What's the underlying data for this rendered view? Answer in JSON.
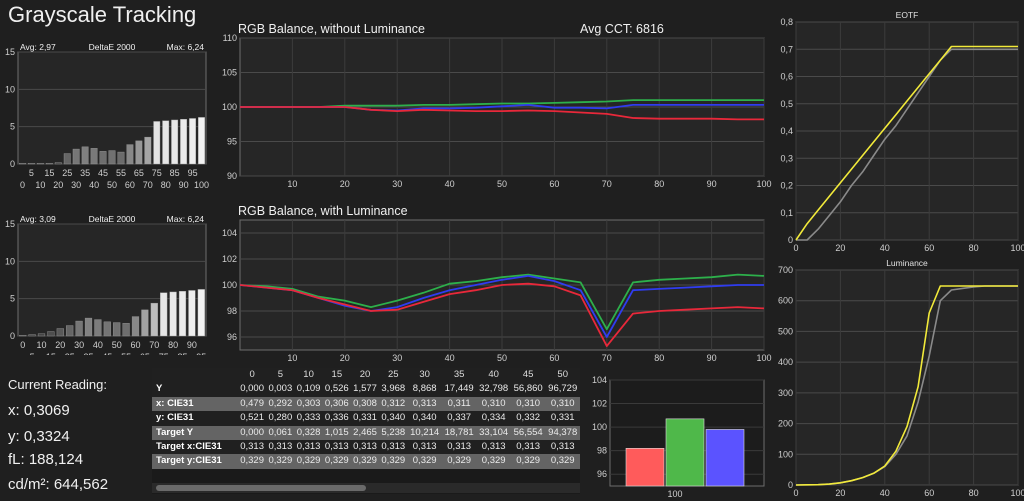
{
  "title": "Grayscale Tracking",
  "reading": {
    "header": "Current Reading:",
    "x": "x: 0,3069",
    "y": "y: 0,3324",
    "fl": "fL: 188,124",
    "cdm2": "cd/m²: 644,562"
  },
  "colors": {
    "red": "#e8283a",
    "green": "#2db04b",
    "blue": "#2f3cf0",
    "yellow": "#f2ea3a",
    "gray": "#8a8a8a"
  },
  "chart_data": [
    {
      "id": "deltae1",
      "type": "bar",
      "title": "DeltaE 2000",
      "avg_label": "Avg: 2,97",
      "max_label": "Max: 6,24",
      "ylim": [
        0,
        15
      ],
      "y_ticks": [
        0,
        5,
        10,
        15
      ],
      "x_ticks": [
        "5",
        "15",
        "25",
        "35",
        "45",
        "55",
        "65",
        "75",
        "85",
        "95"
      ],
      "x_ticks_b": [
        "0",
        "10",
        "20",
        "30",
        "40",
        "50",
        "60",
        "70",
        "80",
        "90",
        "100"
      ],
      "categories": [
        "0",
        "5",
        "10",
        "15",
        "20",
        "25",
        "30",
        "35",
        "40",
        "45",
        "50",
        "55",
        "60",
        "65",
        "70",
        "75",
        "80",
        "85",
        "90",
        "95",
        "100"
      ],
      "values": [
        0.1,
        0.1,
        0.1,
        0.1,
        0.2,
        1.4,
        2.0,
        2.3,
        2.1,
        1.7,
        1.8,
        1.6,
        2.6,
        3.1,
        3.6,
        5.7,
        5.8,
        5.9,
        6.0,
        6.1,
        6.24
      ]
    },
    {
      "id": "deltae2",
      "type": "bar",
      "title": "DeltaE 2000",
      "avg_label": "Avg: 3,09",
      "max_label": "Max: 6,24",
      "ylim": [
        0,
        15
      ],
      "y_ticks": [
        0,
        5,
        10,
        15
      ],
      "x_ticks": [
        "0",
        "10",
        "20",
        "30",
        "40",
        "50",
        "60",
        "70",
        "80",
        "90"
      ],
      "x_ticks_b": [
        "5",
        "15",
        "25",
        "35",
        "45",
        "55",
        "65",
        "75",
        "85",
        "95"
      ],
      "categories": [
        "0",
        "5",
        "10",
        "15",
        "20",
        "25",
        "30",
        "35",
        "40",
        "45",
        "50",
        "55",
        "60",
        "65",
        "70",
        "75",
        "80",
        "85",
        "90",
        "95"
      ],
      "values": [
        0.1,
        0.2,
        0.3,
        0.6,
        1.0,
        1.4,
        2.0,
        2.4,
        2.2,
        1.9,
        1.8,
        1.7,
        2.6,
        3.5,
        4.4,
        5.8,
        5.9,
        6.0,
        6.1,
        6.24
      ]
    },
    {
      "id": "rgb1",
      "type": "line",
      "title": "RGB Balance, without Luminance",
      "subtitle": "Avg CCT: 6816",
      "xlim": [
        0,
        100
      ],
      "ylim": [
        90,
        110
      ],
      "y_ticks": [
        90,
        95,
        100,
        105,
        110
      ],
      "x_ticks": [
        10,
        20,
        30,
        40,
        50,
        60,
        70,
        80,
        90,
        100
      ],
      "x": [
        0,
        5,
        10,
        15,
        20,
        25,
        30,
        35,
        40,
        45,
        50,
        55,
        60,
        65,
        70,
        75,
        80,
        85,
        90,
        95,
        100
      ],
      "series": [
        {
          "color": "green",
          "values": [
            100,
            100,
            100,
            100,
            100.2,
            100.2,
            100.2,
            100.3,
            100.3,
            100.4,
            100.5,
            100.5,
            100.6,
            100.7,
            100.8,
            101.0,
            101.0,
            101.0,
            101.0,
            101.0,
            101.0
          ]
        },
        {
          "color": "blue",
          "values": [
            100,
            100,
            100,
            100,
            100,
            99.6,
            99.5,
            99.8,
            99.8,
            99.9,
            100.1,
            100.3,
            99.9,
            99.9,
            99.8,
            100.3,
            100.3,
            100.3,
            100.3,
            100.3,
            100.3
          ]
        },
        {
          "color": "red",
          "values": [
            100,
            100,
            100,
            100,
            100,
            99.6,
            99.4,
            99.6,
            99.5,
            99.4,
            99.4,
            99.5,
            99.4,
            99.2,
            99.0,
            98.4,
            98.3,
            98.3,
            98.3,
            98.2,
            98.2
          ]
        }
      ]
    },
    {
      "id": "rgb2",
      "type": "line",
      "title": "RGB Balance, with Luminance",
      "xlim": [
        0,
        100
      ],
      "ylim": [
        95,
        105
      ],
      "y_ticks": [
        96,
        98,
        100,
        102,
        104
      ],
      "x_ticks": [
        10,
        20,
        30,
        40,
        50,
        60,
        70,
        80,
        90,
        100
      ],
      "x": [
        0,
        5,
        10,
        15,
        20,
        25,
        30,
        35,
        40,
        45,
        50,
        55,
        60,
        65,
        70,
        75,
        80,
        85,
        90,
        95,
        100
      ],
      "series": [
        {
          "color": "green",
          "values": [
            100,
            99.9,
            99.7,
            99.1,
            98.8,
            98.3,
            98.8,
            99.4,
            100.1,
            100.3,
            100.6,
            100.8,
            100.5,
            100.2,
            96.6,
            100.2,
            100.4,
            100.5,
            100.6,
            100.8,
            100.7
          ]
        },
        {
          "color": "blue",
          "values": [
            100,
            99.8,
            99.6,
            99.0,
            98.4,
            98.0,
            98.3,
            99.0,
            99.6,
            100.0,
            100.4,
            100.7,
            100.3,
            99.6,
            96.0,
            99.6,
            99.7,
            99.8,
            99.9,
            100.0,
            100.0
          ]
        },
        {
          "color": "red",
          "values": [
            100,
            99.8,
            99.6,
            99.0,
            98.5,
            98.0,
            98.1,
            98.7,
            99.3,
            99.6,
            100.0,
            100.1,
            99.9,
            99.2,
            95.3,
            97.8,
            98.0,
            98.1,
            98.2,
            98.3,
            98.2
          ]
        }
      ]
    },
    {
      "id": "eotf",
      "type": "line",
      "title": "EOTF",
      "xlim": [
        0,
        100
      ],
      "ylim": [
        0,
        0.8
      ],
      "y_ticks": [
        0,
        0.1,
        0.2,
        0.3,
        0.4,
        0.5,
        0.6,
        0.7,
        0.8
      ],
      "y_tick_labels": [
        "0",
        "0,1",
        "0,2",
        "0,3",
        "0,4",
        "0,5",
        "0,6",
        "0,7",
        "0,8"
      ],
      "x_ticks": [
        0,
        20,
        40,
        60,
        80,
        100
      ],
      "x": [
        0,
        5,
        10,
        15,
        20,
        25,
        30,
        35,
        40,
        45,
        50,
        55,
        60,
        65,
        70,
        75,
        80,
        85,
        90,
        95,
        100
      ],
      "series": [
        {
          "color": "gray",
          "values": [
            0,
            0.0,
            0.04,
            0.09,
            0.14,
            0.2,
            0.25,
            0.31,
            0.37,
            0.42,
            0.48,
            0.54,
            0.6,
            0.66,
            0.7,
            0.7,
            0.7,
            0.7,
            0.7,
            0.7,
            0.7
          ]
        },
        {
          "color": "yellow",
          "values": [
            0,
            0.06,
            0.11,
            0.16,
            0.21,
            0.26,
            0.31,
            0.36,
            0.41,
            0.46,
            0.51,
            0.56,
            0.61,
            0.66,
            0.71,
            0.71,
            0.71,
            0.71,
            0.71,
            0.71,
            0.71
          ]
        }
      ]
    },
    {
      "id": "lum",
      "type": "line",
      "title": "Luminance",
      "xlim": [
        0,
        100
      ],
      "ylim": [
        0,
        700
      ],
      "y_ticks": [
        0,
        100,
        200,
        300,
        400,
        500,
        600,
        700
      ],
      "x_ticks": [
        0,
        20,
        40,
        60,
        80,
        100
      ],
      "x": [
        0,
        5,
        10,
        15,
        20,
        25,
        30,
        35,
        40,
        45,
        50,
        55,
        60,
        65,
        70,
        75,
        80,
        85,
        90,
        95,
        100
      ],
      "series": [
        {
          "color": "gray",
          "values": [
            0,
            0.5,
            1,
            3,
            7,
            14,
            24,
            38,
            60,
            100,
            160,
            270,
            420,
            600,
            635,
            640,
            645,
            648,
            648,
            648,
            648
          ]
        },
        {
          "color": "yellow",
          "values": [
            0,
            0.5,
            1,
            3,
            7,
            14,
            24,
            38,
            62,
            110,
            190,
            320,
            560,
            648,
            648,
            648,
            648,
            648,
            648,
            648,
            648
          ]
        }
      ]
    },
    {
      "id": "rgbbar",
      "type": "bar",
      "ylim": [
        95,
        104
      ],
      "y_ticks": [
        96,
        98,
        100,
        102,
        104
      ],
      "categories": [
        "100"
      ],
      "series": [
        {
          "color": "red",
          "values": [
            98.2
          ]
        },
        {
          "color": "green",
          "values": [
            100.7
          ]
        },
        {
          "color": "blue",
          "values": [
            99.8
          ]
        }
      ]
    }
  ],
  "table": {
    "columns": [
      "",
      "0",
      "5",
      "10",
      "15",
      "20",
      "25",
      "30",
      "35",
      "40",
      "45",
      "50"
    ],
    "rows": [
      {
        "label": "Y",
        "values": [
          "0,000",
          "0,003",
          "0,109",
          "0,526",
          "1,577",
          "3,968",
          "8,868",
          "17,449",
          "32,798",
          "56,860",
          "96,729"
        ]
      },
      {
        "label": "x: CIE31",
        "values": [
          "0,479",
          "0,292",
          "0,303",
          "0,306",
          "0,308",
          "0,312",
          "0,313",
          "0,311",
          "0,310",
          "0,310",
          "0,310"
        ]
      },
      {
        "label": "y: CIE31",
        "values": [
          "0,521",
          "0,280",
          "0,333",
          "0,336",
          "0,331",
          "0,340",
          "0,340",
          "0,337",
          "0,334",
          "0,332",
          "0,331"
        ]
      },
      {
        "label": "Target Y",
        "values": [
          "0,000",
          "0,061",
          "0,328",
          "1,015",
          "2,465",
          "5,238",
          "10,214",
          "18,781",
          "33,104",
          "56,554",
          "94,378"
        ]
      },
      {
        "label": "Target x:CIE31",
        "values": [
          "0,313",
          "0,313",
          "0,313",
          "0,313",
          "0,313",
          "0,313",
          "0,313",
          "0,313",
          "0,313",
          "0,313",
          "0,313"
        ]
      },
      {
        "label": "Target y:CIE31",
        "values": [
          "0,329",
          "0,329",
          "0,329",
          "0,329",
          "0,329",
          "0,329",
          "0,329",
          "0,329",
          "0,329",
          "0,329",
          "0,329"
        ]
      }
    ]
  }
}
